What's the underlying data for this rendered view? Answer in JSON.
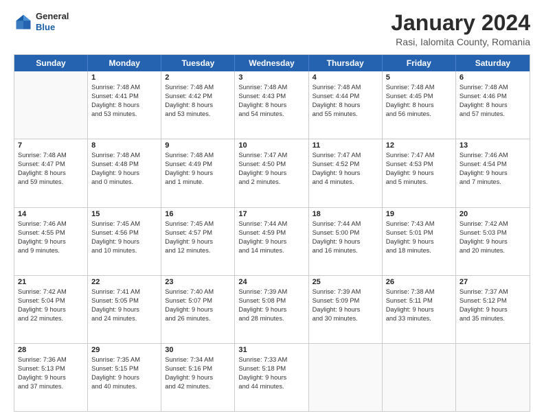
{
  "header": {
    "logo_line1": "General",
    "logo_line2": "Blue",
    "title": "January 2024",
    "subtitle": "Rasi, Ialomita County, Romania"
  },
  "calendar": {
    "days_of_week": [
      "Sunday",
      "Monday",
      "Tuesday",
      "Wednesday",
      "Thursday",
      "Friday",
      "Saturday"
    ],
    "rows": [
      [
        {
          "day": "",
          "info": ""
        },
        {
          "day": "1",
          "info": "Sunrise: 7:48 AM\nSunset: 4:41 PM\nDaylight: 8 hours\nand 53 minutes."
        },
        {
          "day": "2",
          "info": "Sunrise: 7:48 AM\nSunset: 4:42 PM\nDaylight: 8 hours\nand 53 minutes."
        },
        {
          "day": "3",
          "info": "Sunrise: 7:48 AM\nSunset: 4:43 PM\nDaylight: 8 hours\nand 54 minutes."
        },
        {
          "day": "4",
          "info": "Sunrise: 7:48 AM\nSunset: 4:44 PM\nDaylight: 8 hours\nand 55 minutes."
        },
        {
          "day": "5",
          "info": "Sunrise: 7:48 AM\nSunset: 4:45 PM\nDaylight: 8 hours\nand 56 minutes."
        },
        {
          "day": "6",
          "info": "Sunrise: 7:48 AM\nSunset: 4:46 PM\nDaylight: 8 hours\nand 57 minutes."
        }
      ],
      [
        {
          "day": "7",
          "info": "Sunrise: 7:48 AM\nSunset: 4:47 PM\nDaylight: 8 hours\nand 59 minutes."
        },
        {
          "day": "8",
          "info": "Sunrise: 7:48 AM\nSunset: 4:48 PM\nDaylight: 9 hours\nand 0 minutes."
        },
        {
          "day": "9",
          "info": "Sunrise: 7:48 AM\nSunset: 4:49 PM\nDaylight: 9 hours\nand 1 minute."
        },
        {
          "day": "10",
          "info": "Sunrise: 7:47 AM\nSunset: 4:50 PM\nDaylight: 9 hours\nand 2 minutes."
        },
        {
          "day": "11",
          "info": "Sunrise: 7:47 AM\nSunset: 4:52 PM\nDaylight: 9 hours\nand 4 minutes."
        },
        {
          "day": "12",
          "info": "Sunrise: 7:47 AM\nSunset: 4:53 PM\nDaylight: 9 hours\nand 5 minutes."
        },
        {
          "day": "13",
          "info": "Sunrise: 7:46 AM\nSunset: 4:54 PM\nDaylight: 9 hours\nand 7 minutes."
        }
      ],
      [
        {
          "day": "14",
          "info": "Sunrise: 7:46 AM\nSunset: 4:55 PM\nDaylight: 9 hours\nand 9 minutes."
        },
        {
          "day": "15",
          "info": "Sunrise: 7:45 AM\nSunset: 4:56 PM\nDaylight: 9 hours\nand 10 minutes."
        },
        {
          "day": "16",
          "info": "Sunrise: 7:45 AM\nSunset: 4:57 PM\nDaylight: 9 hours\nand 12 minutes."
        },
        {
          "day": "17",
          "info": "Sunrise: 7:44 AM\nSunset: 4:59 PM\nDaylight: 9 hours\nand 14 minutes."
        },
        {
          "day": "18",
          "info": "Sunrise: 7:44 AM\nSunset: 5:00 PM\nDaylight: 9 hours\nand 16 minutes."
        },
        {
          "day": "19",
          "info": "Sunrise: 7:43 AM\nSunset: 5:01 PM\nDaylight: 9 hours\nand 18 minutes."
        },
        {
          "day": "20",
          "info": "Sunrise: 7:42 AM\nSunset: 5:03 PM\nDaylight: 9 hours\nand 20 minutes."
        }
      ],
      [
        {
          "day": "21",
          "info": "Sunrise: 7:42 AM\nSunset: 5:04 PM\nDaylight: 9 hours\nand 22 minutes."
        },
        {
          "day": "22",
          "info": "Sunrise: 7:41 AM\nSunset: 5:05 PM\nDaylight: 9 hours\nand 24 minutes."
        },
        {
          "day": "23",
          "info": "Sunrise: 7:40 AM\nSunset: 5:07 PM\nDaylight: 9 hours\nand 26 minutes."
        },
        {
          "day": "24",
          "info": "Sunrise: 7:39 AM\nSunset: 5:08 PM\nDaylight: 9 hours\nand 28 minutes."
        },
        {
          "day": "25",
          "info": "Sunrise: 7:39 AM\nSunset: 5:09 PM\nDaylight: 9 hours\nand 30 minutes."
        },
        {
          "day": "26",
          "info": "Sunrise: 7:38 AM\nSunset: 5:11 PM\nDaylight: 9 hours\nand 33 minutes."
        },
        {
          "day": "27",
          "info": "Sunrise: 7:37 AM\nSunset: 5:12 PM\nDaylight: 9 hours\nand 35 minutes."
        }
      ],
      [
        {
          "day": "28",
          "info": "Sunrise: 7:36 AM\nSunset: 5:13 PM\nDaylight: 9 hours\nand 37 minutes."
        },
        {
          "day": "29",
          "info": "Sunrise: 7:35 AM\nSunset: 5:15 PM\nDaylight: 9 hours\nand 40 minutes."
        },
        {
          "day": "30",
          "info": "Sunrise: 7:34 AM\nSunset: 5:16 PM\nDaylight: 9 hours\nand 42 minutes."
        },
        {
          "day": "31",
          "info": "Sunrise: 7:33 AM\nSunset: 5:18 PM\nDaylight: 9 hours\nand 44 minutes."
        },
        {
          "day": "",
          "info": ""
        },
        {
          "day": "",
          "info": ""
        },
        {
          "day": "",
          "info": ""
        }
      ]
    ]
  }
}
